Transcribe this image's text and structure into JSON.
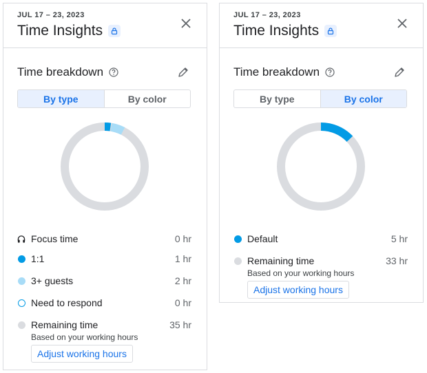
{
  "colors": {
    "accent": "#1a73e8",
    "one_on_one": "#039be5",
    "guests": "#a8dcf7",
    "need_to_respond": "#039be5",
    "remaining": "#dadce0",
    "default": "#039be5"
  },
  "left": {
    "date_range": "JUL 17 – 23, 2023",
    "title": "Time Insights",
    "section_title": "Time breakdown",
    "tabs": [
      {
        "label": "By type",
        "active": true
      },
      {
        "label": "By color",
        "active": false
      }
    ],
    "legend": [
      {
        "icon": "headphones-icon",
        "label": "Focus time",
        "value": "0 hr"
      },
      {
        "icon": "dot-filled",
        "label": "1:1",
        "value": "1 hr"
      },
      {
        "icon": "dot-light",
        "label": "3+ guests",
        "value": "2 hr"
      },
      {
        "icon": "dot-outline",
        "label": "Need to respond",
        "value": "0 hr"
      },
      {
        "icon": "dot-grey",
        "label": "Remaining time",
        "value": "35 hr"
      }
    ],
    "remaining_note": "Based on your working hours",
    "adjust_label": "Adjust working hours",
    "donut": {
      "total_hours": 38,
      "segments": [
        {
          "name": "1:1",
          "hours": 1,
          "color": "#039be5"
        },
        {
          "name": "3+ guests",
          "hours": 2,
          "color": "#a8dcf7"
        },
        {
          "name": "Remaining time",
          "hours": 35,
          "color": "#dadce0"
        }
      ]
    }
  },
  "right": {
    "date_range": "JUL 17 – 23, 2023",
    "title": "Time Insights",
    "section_title": "Time breakdown",
    "tabs": [
      {
        "label": "By type",
        "active": false
      },
      {
        "label": "By color",
        "active": true
      }
    ],
    "legend": [
      {
        "icon": "dot-filled",
        "label": "Default",
        "value": "5 hr"
      },
      {
        "icon": "dot-grey",
        "label": "Remaining time",
        "value": "33 hr"
      }
    ],
    "remaining_note": "Based on your working hours",
    "adjust_label": "Adjust working hours",
    "donut": {
      "total_hours": 38,
      "segments": [
        {
          "name": "Default",
          "hours": 5,
          "color": "#039be5"
        },
        {
          "name": "Remaining time",
          "hours": 33,
          "color": "#dadce0"
        }
      ]
    }
  }
}
